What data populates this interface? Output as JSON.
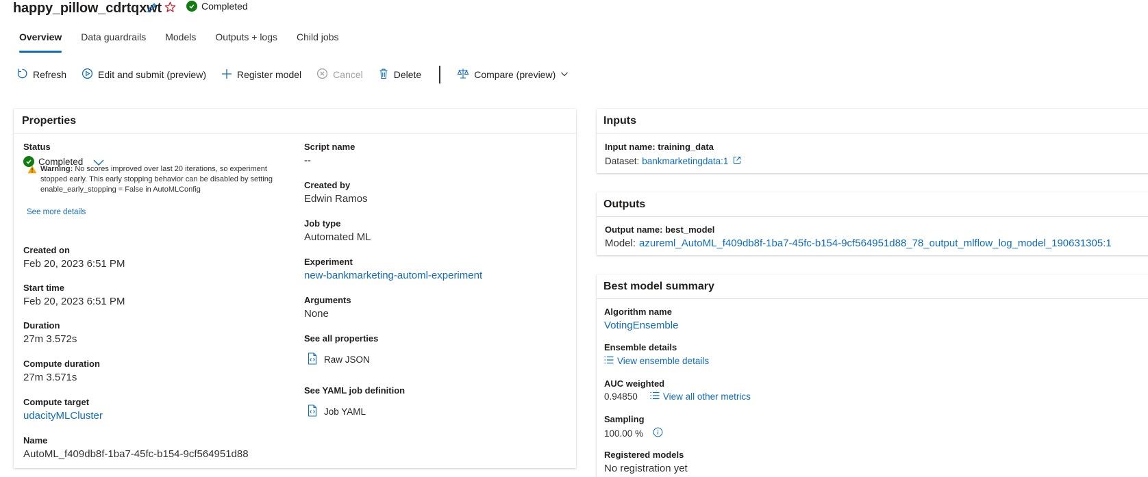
{
  "header": {
    "title": "happy_pillow_cdrtqxwt",
    "status": "Completed"
  },
  "tabs": [
    "Overview",
    "Data guardrails",
    "Models",
    "Outputs + logs",
    "Child jobs"
  ],
  "toolbar": {
    "refresh": "Refresh",
    "edit_submit": "Edit and submit (preview)",
    "register_model": "Register model",
    "cancel": "Cancel",
    "delete": "Delete",
    "compare": "Compare (preview)"
  },
  "properties": {
    "title": "Properties",
    "status_label": "Status",
    "status_value": "Completed",
    "warning_title": "Warning:",
    "warning_text": "No scores improved over last 20 iterations, so experiment stopped early. This early stopping behavior can be disabled by setting enable_early_stopping = False in AutoMLConfig",
    "see_more": "See more details",
    "created_on_label": "Created on",
    "created_on_value": "Feb 20, 2023 6:51 PM",
    "start_time_label": "Start time",
    "start_time_value": "Feb 20, 2023 6:51 PM",
    "duration_label": "Duration",
    "duration_value": "27m 3.572s",
    "compute_duration_label": "Compute duration",
    "compute_duration_value": "27m 3.571s",
    "compute_target_label": "Compute target",
    "compute_target_value": "udacityMLCluster",
    "name_label": "Name",
    "name_value": "AutoML_f409db8f-1ba7-45fc-b154-9cf564951d88",
    "script_name_label": "Script name",
    "script_name_value": "--",
    "created_by_label": "Created by",
    "created_by_value": "Edwin Ramos",
    "job_type_label": "Job type",
    "job_type_value": "Automated ML",
    "experiment_label": "Experiment",
    "experiment_value": "new-bankmarketing-automl-experiment",
    "arguments_label": "Arguments",
    "arguments_value": "None",
    "see_all_label": "See all properties",
    "raw_json": "Raw JSON",
    "yaml_label": "See YAML job definition",
    "job_yaml": "Job YAML"
  },
  "inputs": {
    "title": "Inputs",
    "input_name": "Input name: training_data",
    "dataset_prefix": "Dataset:",
    "dataset_link": "bankmarketingdata:1"
  },
  "outputs": {
    "title": "Outputs",
    "output_name": "Output name: best_model",
    "model_prefix": "Model:",
    "model_link": "azureml_AutoML_f409db8f-1ba7-45fc-b154-9cf564951d88_78_output_mlflow_log_model_190631305:1"
  },
  "best_model": {
    "title": "Best model summary",
    "algorithm_label": "Algorithm name",
    "algorithm_value": "VotingEnsemble",
    "ensemble_label": "Ensemble details",
    "ensemble_link": "View ensemble details",
    "auc_label": "AUC weighted",
    "auc_value": "0.94850",
    "metrics_link": "View all other metrics",
    "sampling_label": "Sampling",
    "sampling_value": "100.00 %",
    "registered_label": "Registered models",
    "registered_value": "No registration yet"
  },
  "colors": {
    "accent": "#0f6cbd",
    "success": "#107c10",
    "warning": "#f7a800"
  }
}
